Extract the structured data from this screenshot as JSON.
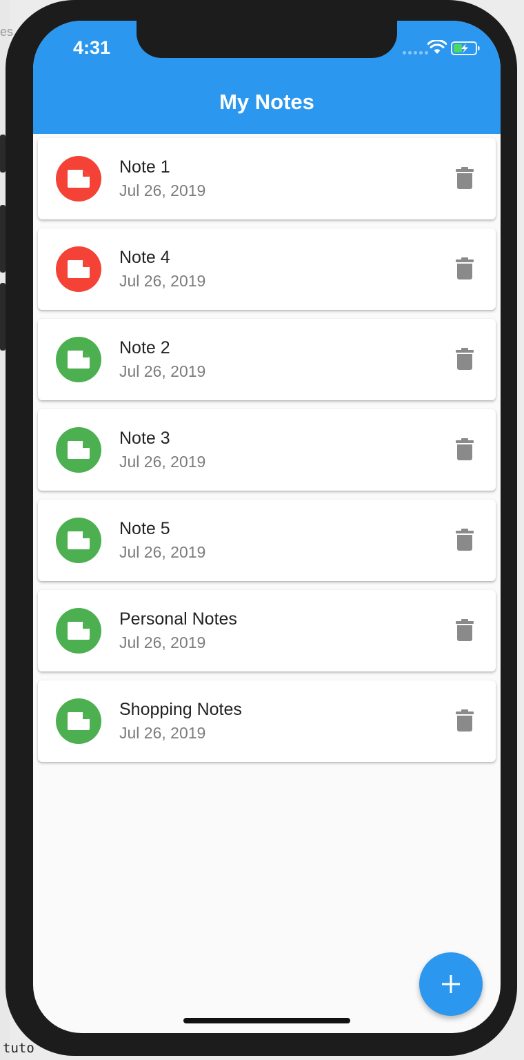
{
  "background": {
    "tab_text": "es",
    "console_text": "tuto"
  },
  "status_bar": {
    "time": "4:31"
  },
  "app_bar": {
    "title": "My Notes"
  },
  "colors": {
    "app_bar": "#2b97ee",
    "priority_high": "#f44336",
    "priority_low": "#4caf50",
    "delete_icon": "#8a8a8a",
    "fab": "#2b97ee"
  },
  "notes": [
    {
      "title": "Note 1",
      "date": "Jul 26, 2019",
      "priority": "high"
    },
    {
      "title": "Note 4",
      "date": "Jul 26, 2019",
      "priority": "high"
    },
    {
      "title": "Note 2",
      "date": "Jul 26, 2019",
      "priority": "low"
    },
    {
      "title": "Note 3",
      "date": "Jul 26, 2019",
      "priority": "low"
    },
    {
      "title": "Note 5",
      "date": "Jul 26, 2019",
      "priority": "low"
    },
    {
      "title": "Personal Notes",
      "date": "Jul 26, 2019",
      "priority": "low"
    },
    {
      "title": "Shopping Notes",
      "date": "Jul 26, 2019",
      "priority": "low"
    }
  ],
  "icons": {
    "note_avatar": "note-icon",
    "delete": "trash-icon",
    "fab": "add-icon",
    "wifi": "wifi-icon",
    "battery": "battery-charging-icon"
  }
}
